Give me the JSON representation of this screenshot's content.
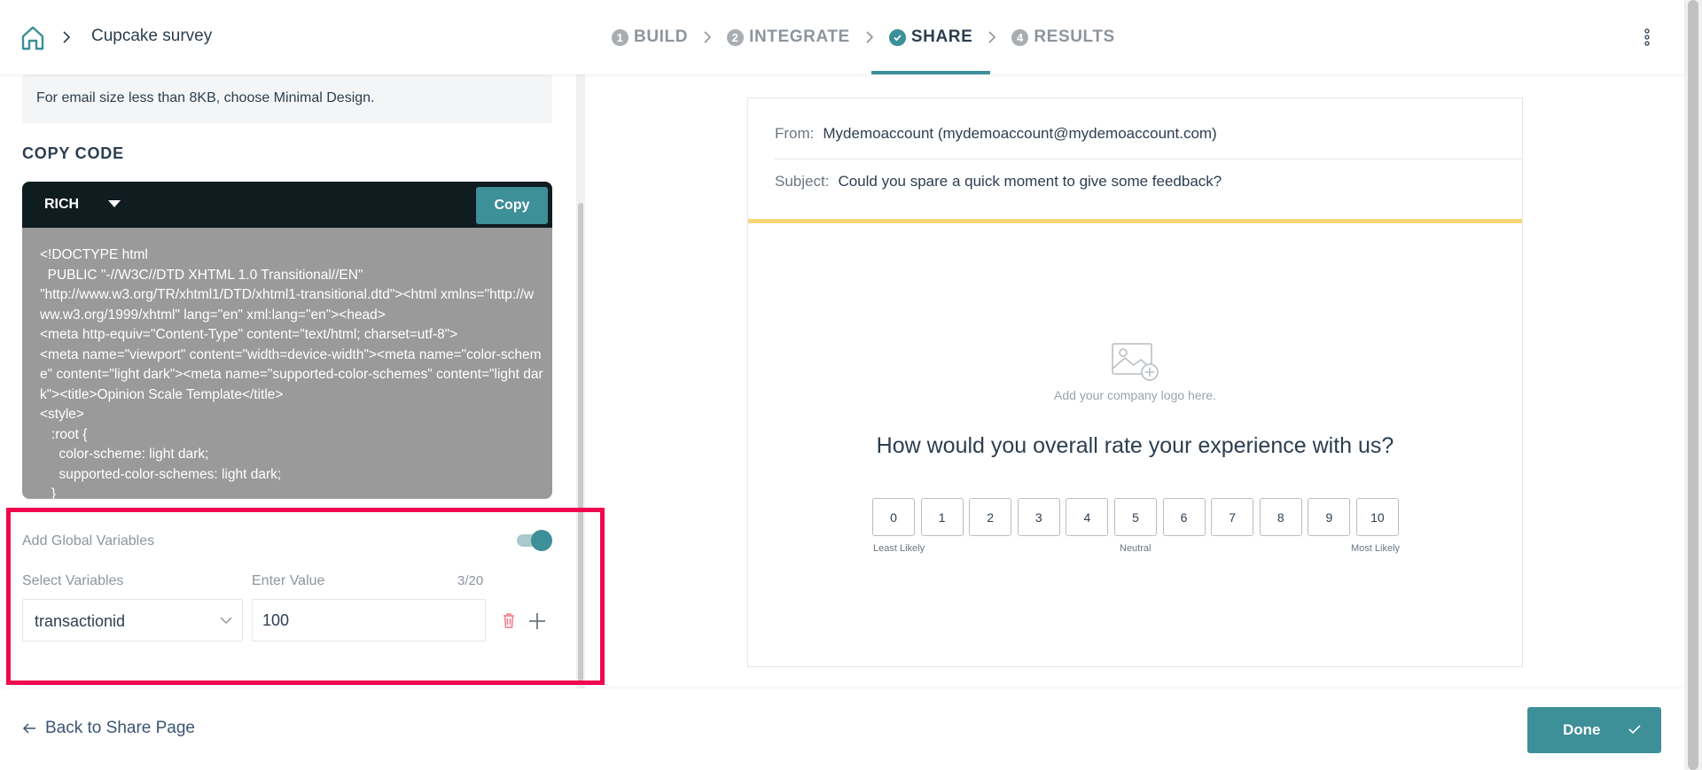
{
  "header": {
    "survey_title": "Cupcake survey",
    "steps": [
      {
        "num": "1",
        "label": "BUILD"
      },
      {
        "num": "2",
        "label": "INTEGRATE"
      },
      {
        "num": "",
        "label": "SHARE"
      },
      {
        "num": "4",
        "label": "RESULTS"
      }
    ],
    "active_step": "SHARE"
  },
  "left": {
    "info_text": "For email size less than 8KB, choose Minimal Design.",
    "copy_code_heading": "COPY CODE",
    "format_selected": "RICH",
    "copy_button": "Copy",
    "code": "<!DOCTYPE html\n  PUBLIC \"-//W3C//DTD XHTML 1.0 Transitional//EN\"\n\"http://www.w3.org/TR/xhtml1/DTD/xhtml1-transitional.dtd\"><html xmlns=\"http://www.w3.org/1999/xhtml\" lang=\"en\" xml:lang=\"en\"><head>\n<meta http-equiv=\"Content-Type\" content=\"text/html; charset=utf-8\">\n<meta name=\"viewport\" content=\"width=device-width\"><meta name=\"color-scheme\" content=\"light dark\"><meta name=\"supported-color-schemes\" content=\"light dark\"><title>Opinion Scale Template</title>\n<style>\n   :root {\n     color-scheme: light dark;\n     supported-color-schemes: light dark;\n   }",
    "global_vars": {
      "label": "Add Global Variables",
      "enabled": true,
      "select_label": "Select Variables",
      "value_label": "Enter Value",
      "char_count": "3/20",
      "selected_variable": "transactionid",
      "value": "100"
    }
  },
  "preview": {
    "from_key": "From:",
    "from_value": "Mydemoaccount (mydemoaccount@mydemoaccount.com)",
    "subject_key": "Subject:",
    "subject_value": "Could you spare a quick moment to give some feedback?",
    "logo_text": "Add your company logo here.",
    "question": "How would you overall rate your experience with us?",
    "scale": [
      "0",
      "1",
      "2",
      "3",
      "4",
      "5",
      "6",
      "7",
      "8",
      "9",
      "10"
    ],
    "scale_labels": {
      "low": "Least Likely",
      "mid": "Neutral",
      "high": "Most Likely"
    },
    "accent_color": "#f4d77a"
  },
  "footer": {
    "back_label": "Back to Share Page",
    "done_label": "Done"
  },
  "colors": {
    "primary": "#3d8f98",
    "highlight": "#f0064f"
  }
}
